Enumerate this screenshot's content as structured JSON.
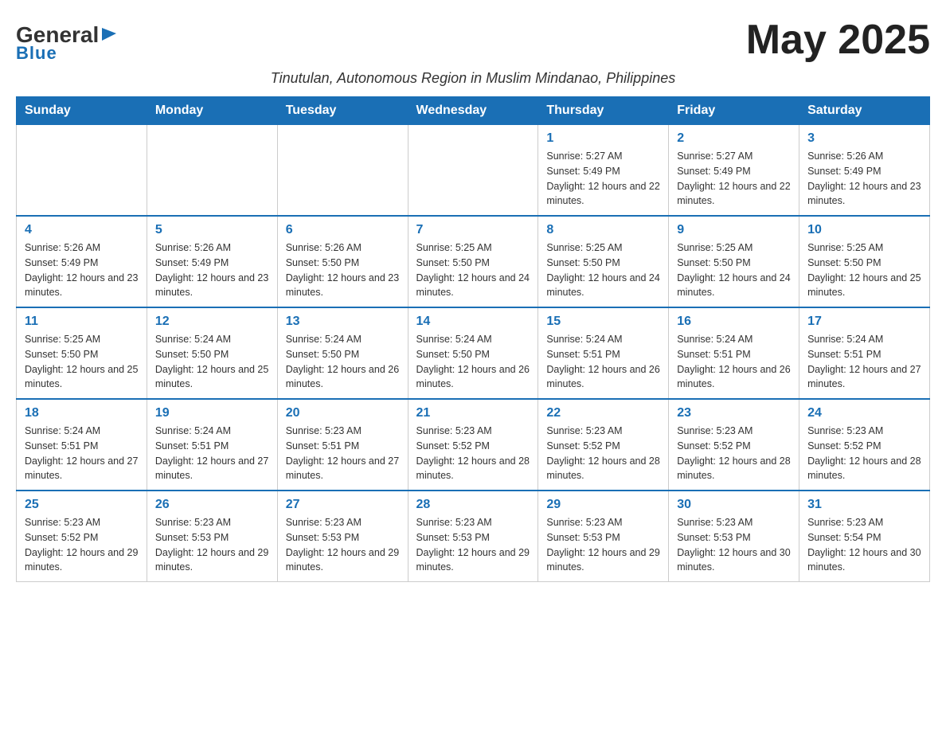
{
  "logo": {
    "general": "General",
    "blue": "Blue",
    "arrow": "▶"
  },
  "title": "May 2025",
  "subtitle": "Tinutulan, Autonomous Region in Muslim Mindanao, Philippines",
  "weekdays": [
    "Sunday",
    "Monday",
    "Tuesday",
    "Wednesday",
    "Thursday",
    "Friday",
    "Saturday"
  ],
  "weeks": [
    [
      {
        "day": "",
        "info": ""
      },
      {
        "day": "",
        "info": ""
      },
      {
        "day": "",
        "info": ""
      },
      {
        "day": "",
        "info": ""
      },
      {
        "day": "1",
        "info": "Sunrise: 5:27 AM\nSunset: 5:49 PM\nDaylight: 12 hours and 22 minutes."
      },
      {
        "day": "2",
        "info": "Sunrise: 5:27 AM\nSunset: 5:49 PM\nDaylight: 12 hours and 22 minutes."
      },
      {
        "day": "3",
        "info": "Sunrise: 5:26 AM\nSunset: 5:49 PM\nDaylight: 12 hours and 23 minutes."
      }
    ],
    [
      {
        "day": "4",
        "info": "Sunrise: 5:26 AM\nSunset: 5:49 PM\nDaylight: 12 hours and 23 minutes."
      },
      {
        "day": "5",
        "info": "Sunrise: 5:26 AM\nSunset: 5:49 PM\nDaylight: 12 hours and 23 minutes."
      },
      {
        "day": "6",
        "info": "Sunrise: 5:26 AM\nSunset: 5:50 PM\nDaylight: 12 hours and 23 minutes."
      },
      {
        "day": "7",
        "info": "Sunrise: 5:25 AM\nSunset: 5:50 PM\nDaylight: 12 hours and 24 minutes."
      },
      {
        "day": "8",
        "info": "Sunrise: 5:25 AM\nSunset: 5:50 PM\nDaylight: 12 hours and 24 minutes."
      },
      {
        "day": "9",
        "info": "Sunrise: 5:25 AM\nSunset: 5:50 PM\nDaylight: 12 hours and 24 minutes."
      },
      {
        "day": "10",
        "info": "Sunrise: 5:25 AM\nSunset: 5:50 PM\nDaylight: 12 hours and 25 minutes."
      }
    ],
    [
      {
        "day": "11",
        "info": "Sunrise: 5:25 AM\nSunset: 5:50 PM\nDaylight: 12 hours and 25 minutes."
      },
      {
        "day": "12",
        "info": "Sunrise: 5:24 AM\nSunset: 5:50 PM\nDaylight: 12 hours and 25 minutes."
      },
      {
        "day": "13",
        "info": "Sunrise: 5:24 AM\nSunset: 5:50 PM\nDaylight: 12 hours and 26 minutes."
      },
      {
        "day": "14",
        "info": "Sunrise: 5:24 AM\nSunset: 5:50 PM\nDaylight: 12 hours and 26 minutes."
      },
      {
        "day": "15",
        "info": "Sunrise: 5:24 AM\nSunset: 5:51 PM\nDaylight: 12 hours and 26 minutes."
      },
      {
        "day": "16",
        "info": "Sunrise: 5:24 AM\nSunset: 5:51 PM\nDaylight: 12 hours and 26 minutes."
      },
      {
        "day": "17",
        "info": "Sunrise: 5:24 AM\nSunset: 5:51 PM\nDaylight: 12 hours and 27 minutes."
      }
    ],
    [
      {
        "day": "18",
        "info": "Sunrise: 5:24 AM\nSunset: 5:51 PM\nDaylight: 12 hours and 27 minutes."
      },
      {
        "day": "19",
        "info": "Sunrise: 5:24 AM\nSunset: 5:51 PM\nDaylight: 12 hours and 27 minutes."
      },
      {
        "day": "20",
        "info": "Sunrise: 5:23 AM\nSunset: 5:51 PM\nDaylight: 12 hours and 27 minutes."
      },
      {
        "day": "21",
        "info": "Sunrise: 5:23 AM\nSunset: 5:52 PM\nDaylight: 12 hours and 28 minutes."
      },
      {
        "day": "22",
        "info": "Sunrise: 5:23 AM\nSunset: 5:52 PM\nDaylight: 12 hours and 28 minutes."
      },
      {
        "day": "23",
        "info": "Sunrise: 5:23 AM\nSunset: 5:52 PM\nDaylight: 12 hours and 28 minutes."
      },
      {
        "day": "24",
        "info": "Sunrise: 5:23 AM\nSunset: 5:52 PM\nDaylight: 12 hours and 28 minutes."
      }
    ],
    [
      {
        "day": "25",
        "info": "Sunrise: 5:23 AM\nSunset: 5:52 PM\nDaylight: 12 hours and 29 minutes."
      },
      {
        "day": "26",
        "info": "Sunrise: 5:23 AM\nSunset: 5:53 PM\nDaylight: 12 hours and 29 minutes."
      },
      {
        "day": "27",
        "info": "Sunrise: 5:23 AM\nSunset: 5:53 PM\nDaylight: 12 hours and 29 minutes."
      },
      {
        "day": "28",
        "info": "Sunrise: 5:23 AM\nSunset: 5:53 PM\nDaylight: 12 hours and 29 minutes."
      },
      {
        "day": "29",
        "info": "Sunrise: 5:23 AM\nSunset: 5:53 PM\nDaylight: 12 hours and 29 minutes."
      },
      {
        "day": "30",
        "info": "Sunrise: 5:23 AM\nSunset: 5:53 PM\nDaylight: 12 hours and 30 minutes."
      },
      {
        "day": "31",
        "info": "Sunrise: 5:23 AM\nSunset: 5:54 PM\nDaylight: 12 hours and 30 minutes."
      }
    ]
  ]
}
